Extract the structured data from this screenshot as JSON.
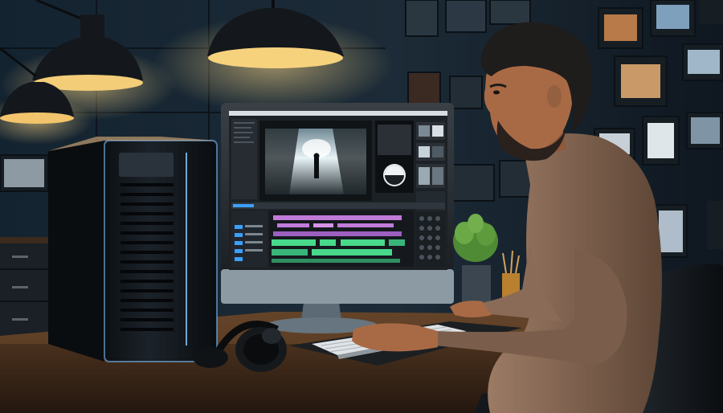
{
  "scene": {
    "palette": {
      "wall_dark": "#0f1a24",
      "wall_mid": "#1d2c38",
      "desk": "#3b2718",
      "desk_light": "#5a3c24",
      "lamp_glow": "#f2c46c",
      "monitor_bezel": "#1a1f24",
      "screen_bg": "#1c2126",
      "timeline_purple": "#c07ad8",
      "timeline_green": "#48d98a",
      "timeline_blue": "#3aa0ff",
      "skin": "#a86a45",
      "hair": "#1f1c1c",
      "sweater": "#8a6b57",
      "plant": "#4f8a34",
      "server_edge": "#7fc2ff"
    },
    "icons": [
      "pendant-lamp-icon",
      "computer-tower-icon",
      "monitor-icon",
      "headphones-icon",
      "keyboard-icon",
      "plant-icon",
      "chair-icon",
      "photo-frame-icon"
    ]
  }
}
